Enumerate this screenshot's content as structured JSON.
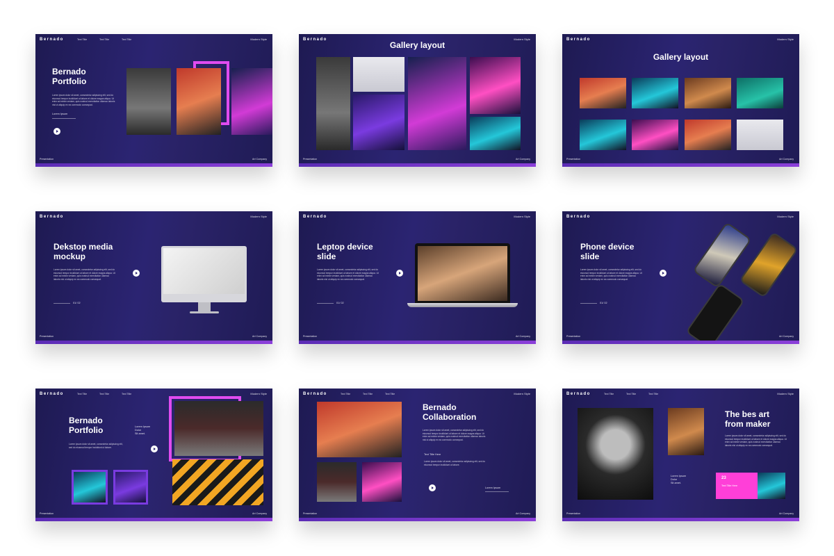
{
  "common": {
    "brand": "Bernado",
    "modern_style": "Modern Style",
    "presentation": "Presentation",
    "art_company": "Art Company",
    "text_title": "Text Title",
    "lorem_ipsum": "Lorem Ipsum",
    "body_lorem": "Lorem ipsum dolor sit amet, consectetur adipiscing elit, sed do eiusmod tempor incididunt ut labore et dolore magna aliqua. Ut enim ad minim veniam, quis nostrud exercitation ullamco laboris nisi ut aliquip ex ea commodo consequat.",
    "body_lorem_short": "Lorem ipsum dolor sit amet, consectetur adipiscing elit, sed do eiusmod tempor incididunt ut labore."
  },
  "slides": [
    {
      "title": "Bernado\nPortfolio",
      "subtitle": "Lorem Ipsum"
    },
    {
      "title": "Gallery layout"
    },
    {
      "title": "Gallery layout"
    },
    {
      "title": "Dekstop media\nmockup",
      "pager": "01/ 02"
    },
    {
      "title": "Leptop device\nslide",
      "pager": "01/ 02"
    },
    {
      "title": "Phone device\nslide",
      "pager": "01/ 02"
    },
    {
      "title": "Bernado\nPortfolio",
      "side_text": "Lorem Ipsum\nDolor\nSit amet."
    },
    {
      "title": "Bernado\nCollaboration",
      "sub": "Text Title Here",
      "link": "Lorem Ipsum"
    },
    {
      "title": "The bes art\nfrom maker",
      "side_text": "Lorem Ipsum\nDolor\nSit amet.",
      "card_num": "23",
      "card_label": "Text Title Here"
    }
  ]
}
